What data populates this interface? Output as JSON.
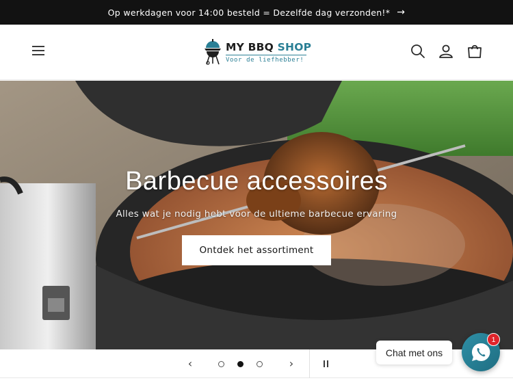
{
  "announcement": {
    "text": "Op werkdagen voor 14:00 besteld = Dezelfde dag verzonden!*",
    "arrow_icon": "arrow-right-icon"
  },
  "header": {
    "menu_icon": "hamburger-menu-icon",
    "logo": {
      "name_part1": "MY BBQ",
      "name_part2": " SHOP",
      "tagline": "Voor de liefhebber!"
    },
    "icons": [
      "search-icon",
      "account-icon",
      "cart-icon"
    ]
  },
  "hero": {
    "title": "Barbecue accessoires",
    "subtitle": "Alles wat je nodig hebt voor de ultieme barbecue ervaring",
    "cta_label": "Ontdek het assortiment"
  },
  "slider": {
    "prev_icon": "chevron-left-icon",
    "next_icon": "chevron-right-icon",
    "slide_count": 3,
    "active_slide": 2,
    "pause_icon": "pause-icon"
  },
  "chat": {
    "label": "Chat met ons",
    "badge_count": "1",
    "icon": "whatsapp-icon"
  },
  "colors": {
    "brand_teal": "#2a7f95",
    "announcement_bg": "#121212",
    "badge_red": "#e0242b"
  }
}
